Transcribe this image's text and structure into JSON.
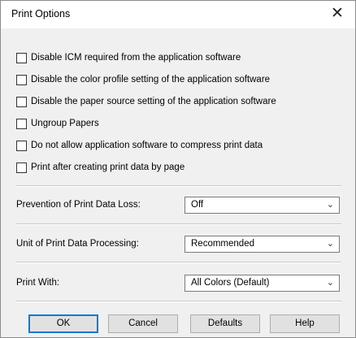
{
  "window": {
    "title": "Print Options",
    "close_glyph": "✕"
  },
  "options": [
    {
      "label": "Disable ICM required from the application software",
      "checked": false
    },
    {
      "label": "Disable the color profile setting of the application software",
      "checked": false
    },
    {
      "label": "Disable the paper source setting of the application software",
      "checked": false
    },
    {
      "label": "Ungroup Papers",
      "checked": false
    },
    {
      "label": "Do not allow application software to compress print data",
      "checked": false
    },
    {
      "label": "Print after creating print data by page",
      "checked": false
    }
  ],
  "fields": {
    "prevention": {
      "label": "Prevention of Print Data Loss:",
      "value": "Off"
    },
    "unit": {
      "label": "Unit of Print Data Processing:",
      "value": "Recommended"
    },
    "print_with": {
      "label": "Print With:",
      "value": "All Colors (Default)"
    }
  },
  "dropdown_arrow_glyph": "⌄",
  "buttons": {
    "ok": "OK",
    "cancel": "Cancel",
    "defaults": "Defaults",
    "help": "Help"
  },
  "colors": {
    "focus_border": "#0078d7",
    "dialog_body": "#f0f0f0"
  }
}
